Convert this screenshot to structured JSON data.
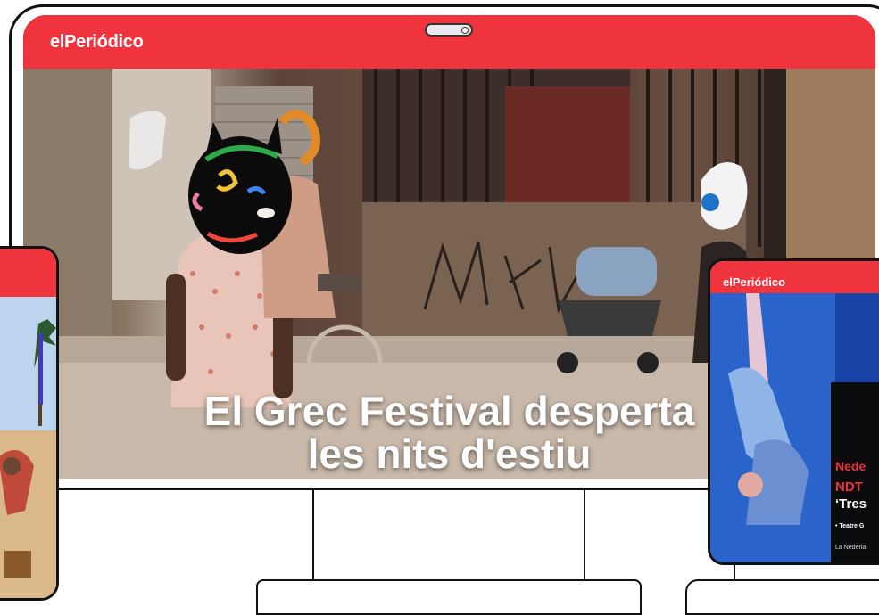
{
  "desktop": {
    "brand": "elPeriódico",
    "headline_line1": "El Grec Festival desperta",
    "headline_line2": "les nits d'estiu"
  },
  "tablet": {
    "brand": "elPeriódico",
    "card_line1": "Nede",
    "card_line2": "NDT",
    "card_line3": "‘Tres",
    "card_meta": "• Teatre G",
    "card_footer": "La Nederla"
  },
  "colors": {
    "brand_red": "#f0343e",
    "card_red": "#e8323c",
    "dark": "#111111"
  }
}
